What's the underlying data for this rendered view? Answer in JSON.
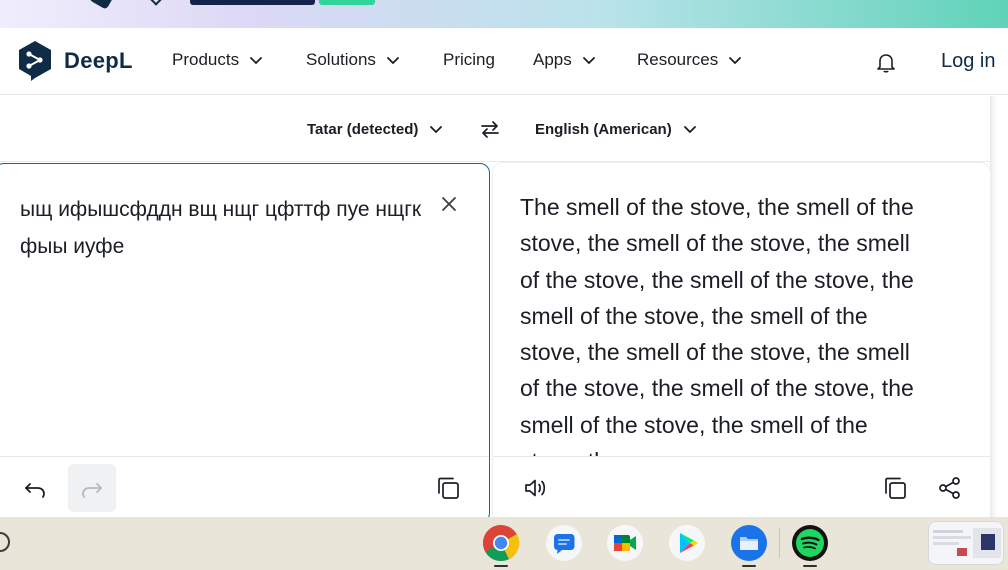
{
  "banner": {
    "text": "",
    "link": ""
  },
  "nav": {
    "brand": "DeepL",
    "menu": [
      {
        "label": "Products"
      },
      {
        "label": "Solutions"
      },
      {
        "label": "Pricing"
      },
      {
        "label": "Apps"
      },
      {
        "label": "Resources"
      }
    ],
    "login": "Log in"
  },
  "languages": {
    "source": "Tatar (detected)",
    "target": "English (American)"
  },
  "source": {
    "text": "ыщ ифышсфддн вщ нщг цфттф пуе нщгк фыы иуфе"
  },
  "target": {
    "text": "The smell of the stove, the smell of the stove, the smell of the stove, the smell of the stove, the smell of the stove, the smell of the stove, the smell of the stove, the smell of the stove, the smell of the stove, the smell of the stove, the smell of the stove, the smell of the stove, the"
  },
  "icons": {
    "swap": "swap-icon",
    "clear": "close-icon",
    "undo": "undo-icon",
    "redo": "redo-icon",
    "copy": "copy-icon",
    "speaker": "speaker-icon",
    "share": "share-icon",
    "bell": "bell-icon"
  },
  "taskbar": {
    "apps": [
      "chrome",
      "messages",
      "meet",
      "play-store",
      "files",
      "spotify"
    ]
  },
  "colors": {
    "brand": "#0f2b46",
    "accent_border": "#0f6b8a"
  }
}
